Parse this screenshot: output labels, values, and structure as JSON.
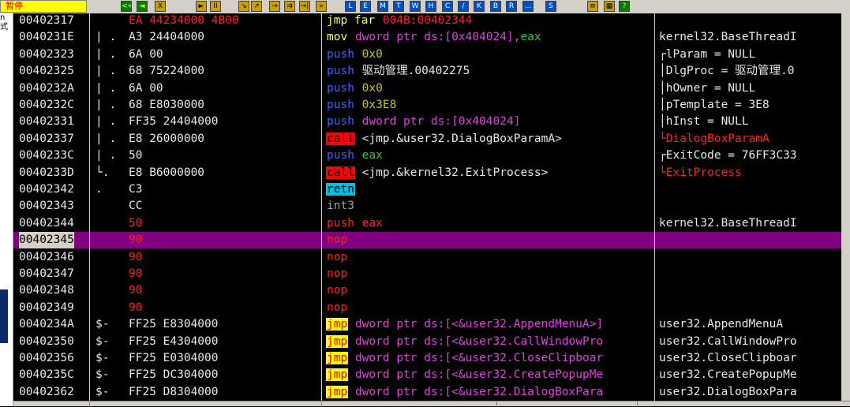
{
  "status_text": "暂停",
  "toolbar_buttons": [
    {
      "label": "<<",
      "icon": "rewind-icon"
    },
    {
      "label": "◄",
      "icon": "back-icon"
    },
    {
      "label": "X",
      "icon": "close-icon"
    },
    {
      "label": "►",
      "icon": "run-icon"
    },
    {
      "label": "II",
      "icon": "pause-icon"
    },
    {
      "label": "↘",
      "icon": "step-into-icon"
    },
    {
      "label": "↗",
      "icon": "step-over-icon"
    },
    {
      "label": "→",
      "icon": "trace-into-icon"
    },
    {
      "label": "⇉",
      "icon": "trace-over-icon"
    },
    {
      "label": "→|",
      "icon": "execute-till-return-icon"
    },
    {
      "label": "»",
      "icon": "go-to-icon"
    },
    {
      "label": "L",
      "icon": "log-window-icon"
    },
    {
      "label": "E",
      "icon": "executables-icon"
    },
    {
      "label": "M",
      "icon": "memory-icon"
    },
    {
      "label": "T",
      "icon": "threads-icon"
    },
    {
      "label": "W",
      "icon": "windows-icon"
    },
    {
      "label": "H",
      "icon": "handles-icon"
    },
    {
      "label": "C",
      "icon": "cpu-icon"
    },
    {
      "label": "/",
      "icon": "patches-icon"
    },
    {
      "label": "K",
      "icon": "call-stack-icon"
    },
    {
      "label": "B",
      "icon": "breakpoints-icon"
    },
    {
      "label": "R",
      "icon": "references-icon"
    },
    {
      "label": "...",
      "icon": "run-trace-icon"
    },
    {
      "label": "S",
      "icon": "source-icon"
    },
    {
      "label": "≡",
      "icon": "options-icon"
    },
    {
      "label": "▦",
      "icon": "windows-list-icon"
    },
    {
      "label": "?",
      "icon": "help-icon"
    }
  ],
  "left_strip_text": [
    "n",
    "式"
  ],
  "rows": [
    {
      "addr": "00402317",
      "mark": "",
      "hex": "EA 44234000 4B00",
      "hex_red": true,
      "mn": "jmp far",
      "mn_style": "jmpfar",
      "ops": [
        {
          "t": "004B:00402344",
          "c": "red"
        }
      ],
      "cmt": "",
      "cmt_red": false
    },
    {
      "addr": "0040231E",
      "mark": "|  .",
      "hex": "A3 24404000",
      "hex_red": false,
      "mn": "mov",
      "mn_style": "yellow",
      "ops": [
        {
          "t": "dword ptr ds:[0x404024],",
          "c": "mag"
        },
        {
          "t": "eax",
          "c": "green"
        }
      ],
      "cmt": "kernel32.BaseThreadI",
      "cmt_red": false
    },
    {
      "addr": "00402323",
      "mark": "|  .",
      "hex": "6A 00",
      "hex_red": false,
      "mn": "push",
      "mn_style": "blue",
      "ops": [
        {
          "t": "0x0",
          "c": "yellow"
        }
      ],
      "cmt": "┌lParam = NULL",
      "cmt_red": false
    },
    {
      "addr": "00402325",
      "mark": "|  .",
      "hex": "68 75224000",
      "hex_red": false,
      "mn": "push",
      "mn_style": "blue",
      "ops": [
        {
          "t": "驱动管理.00402275",
          "c": "white"
        }
      ],
      "cmt": "│DlgProc = 驱动管理.0",
      "cmt_red": false
    },
    {
      "addr": "0040232A",
      "mark": "|  .",
      "hex": "6A 00",
      "hex_red": false,
      "mn": "push",
      "mn_style": "blue",
      "ops": [
        {
          "t": "0x0",
          "c": "yellow"
        }
      ],
      "cmt": "│hOwner = NULL",
      "cmt_red": false
    },
    {
      "addr": "0040232C",
      "mark": "|  .",
      "hex": "68 E8030000",
      "hex_red": false,
      "mn": "push",
      "mn_style": "blue",
      "ops": [
        {
          "t": "0x3E8",
          "c": "yellow"
        }
      ],
      "cmt": "│pTemplate = 3E8",
      "cmt_red": false
    },
    {
      "addr": "00402331",
      "mark": "|  .",
      "hex": "FF35 24404000",
      "hex_red": false,
      "mn": "push",
      "mn_style": "blue",
      "ops": [
        {
          "t": "dword ptr ds:[0x404024]",
          "c": "mag"
        }
      ],
      "cmt": "│hInst = NULL",
      "cmt_red": false
    },
    {
      "addr": "00402337",
      "mark": "|  .",
      "hex": "E8 26000000",
      "hex_red": false,
      "mn": "call",
      "mn_style": "call",
      "ops": [
        {
          "t": "<jmp.&user32.DialogBoxParamA>",
          "c": "white"
        }
      ],
      "cmt": "└DialogBoxParamA",
      "cmt_red": true
    },
    {
      "addr": "0040233C",
      "mark": "|  .",
      "hex": "50",
      "hex_red": false,
      "mn": "push",
      "mn_style": "blue",
      "ops": [
        {
          "t": "eax",
          "c": "green"
        }
      ],
      "cmt": "┌ExitCode = 76FF3C33",
      "cmt_red": false
    },
    {
      "addr": "0040233D",
      "mark": "└.",
      "hex": "E8 B6000000",
      "hex_red": false,
      "mn": "call",
      "mn_style": "call",
      "ops": [
        {
          "t": "<jmp.&kernel32.ExitProcess>",
          "c": "white"
        }
      ],
      "cmt": "└ExitProcess",
      "cmt_red": true
    },
    {
      "addr": "00402342",
      "mark": "   .",
      "hex": "C3",
      "hex_red": false,
      "mn": "retn",
      "mn_style": "retn",
      "ops": [],
      "cmt": "",
      "cmt_red": false
    },
    {
      "addr": "00402343",
      "mark": "",
      "hex": "CC",
      "hex_red": false,
      "mn": "int3",
      "mn_style": "gray",
      "ops": [],
      "cmt": "",
      "cmt_red": false
    },
    {
      "addr": "00402344",
      "mark": "",
      "hex": "50",
      "hex_red": true,
      "mn": "push",
      "mn_style": "red",
      "ops": [
        {
          "t": "eax",
          "c": "red"
        }
      ],
      "cmt": "kernel32.BaseThreadI",
      "cmt_red": false
    },
    {
      "addr": "00402345",
      "mark": "",
      "hex": "90",
      "hex_red": true,
      "mn": "nop",
      "mn_style": "red",
      "ops": [],
      "cmt": "",
      "cmt_red": false,
      "selected": true
    },
    {
      "addr": "00402346",
      "mark": "",
      "hex": "90",
      "hex_red": true,
      "mn": "nop",
      "mn_style": "red",
      "ops": [],
      "cmt": "",
      "cmt_red": false
    },
    {
      "addr": "00402347",
      "mark": "",
      "hex": "90",
      "hex_red": true,
      "mn": "nop",
      "mn_style": "red",
      "ops": [],
      "cmt": "",
      "cmt_red": false
    },
    {
      "addr": "00402348",
      "mark": "",
      "hex": "90",
      "hex_red": true,
      "mn": "nop",
      "mn_style": "red",
      "ops": [],
      "cmt": "",
      "cmt_red": false
    },
    {
      "addr": "00402349",
      "mark": "",
      "hex": "90",
      "hex_red": true,
      "mn": "nop",
      "mn_style": "red",
      "ops": [],
      "cmt": "",
      "cmt_red": false
    },
    {
      "addr": "0040234A",
      "mark": "$-",
      "hex": "FF25 E8304000",
      "hex_red": false,
      "mn": "jmp",
      "mn_style": "jmp",
      "ops": [
        {
          "t": "dword ptr ds:[<&user32.AppendMenuA>]",
          "c": "mag"
        }
      ],
      "cmt": "user32.AppendMenuA",
      "cmt_red": false
    },
    {
      "addr": "00402350",
      "mark": "$-",
      "hex": "FF25 E4304000",
      "hex_red": false,
      "mn": "jmp",
      "mn_style": "jmp",
      "ops": [
        {
          "t": "dword ptr ds:[<&user32.CallWindowPro",
          "c": "mag"
        }
      ],
      "cmt": "user32.CallWindowPro",
      "cmt_red": false
    },
    {
      "addr": "00402356",
      "mark": "$-",
      "hex": "FF25 E0304000",
      "hex_red": false,
      "mn": "jmp",
      "mn_style": "jmp",
      "ops": [
        {
          "t": "dword ptr ds:[<&user32.CloseClipboar",
          "c": "mag"
        }
      ],
      "cmt": "user32.CloseClipboar",
      "cmt_red": false
    },
    {
      "addr": "0040235C",
      "mark": "$-",
      "hex": "FF25 DC304000",
      "hex_red": false,
      "mn": "jmp",
      "mn_style": "jmp",
      "ops": [
        {
          "t": "dword ptr ds:[<&user32.CreatePopupMe",
          "c": "mag"
        }
      ],
      "cmt": "user32.CreatePopupMe",
      "cmt_red": false
    },
    {
      "addr": "00402362",
      "mark": "$-",
      "hex": "FF25 D8304000",
      "hex_red": false,
      "mn": "jmp",
      "mn_style": "jmp",
      "ops": [
        {
          "t": "dword ptr ds:[<&user32.DialogBoxPara",
          "c": "mag"
        }
      ],
      "cmt": "user32.DialogBoxPara",
      "cmt_red": false
    }
  ]
}
